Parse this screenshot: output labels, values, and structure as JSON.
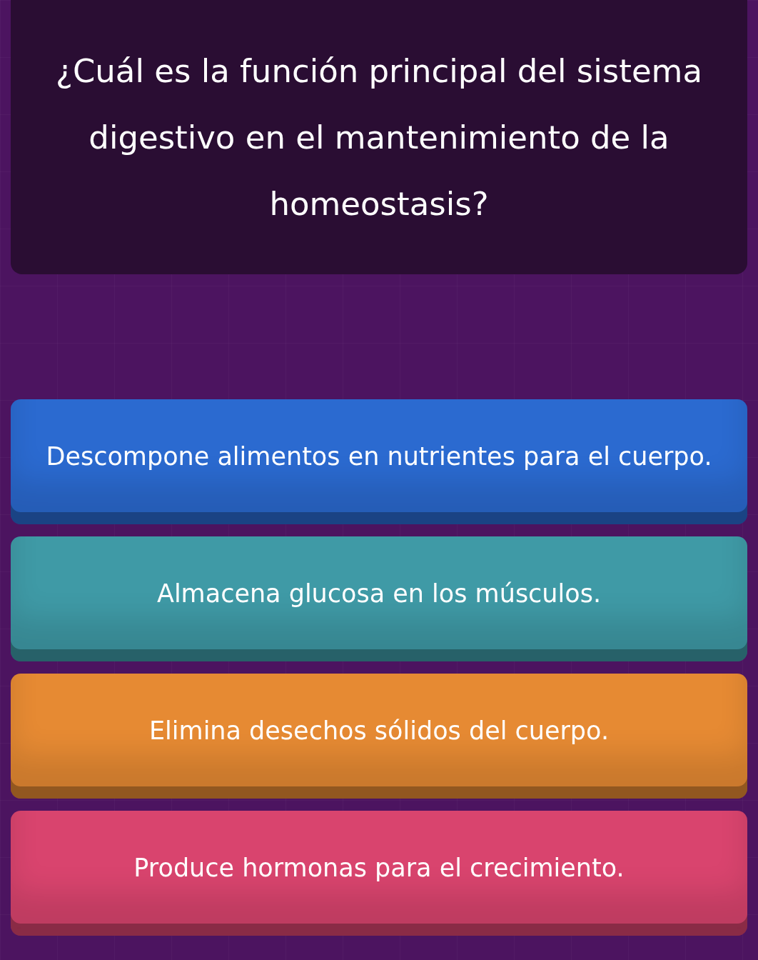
{
  "question": "¿Cuál es la función principal del sistema digestivo en el mantenimiento de la homeostasis?",
  "options": [
    {
      "text": "Descompone alimentos en nutrientes para el cuerpo.",
      "color": "#2b6ad0"
    },
    {
      "text": "Almacena glucosa en los músculos.",
      "color": "#3f9aa6"
    },
    {
      "text": "Elimina desechos sólidos del cuerpo.",
      "color": "#e68a33"
    },
    {
      "text": "Produce hormonas para el crecimiento.",
      "color": "#d9446e"
    }
  ]
}
